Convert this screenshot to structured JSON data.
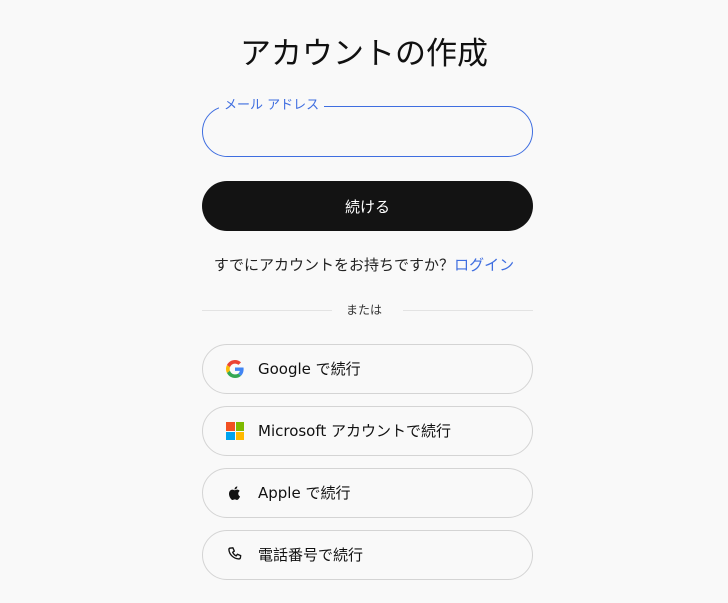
{
  "page": {
    "title": "アカウントの作成"
  },
  "email_field": {
    "label": "メール アドレス",
    "value": "",
    "accent_color": "#3f6ee0"
  },
  "continue_button": {
    "label": "続ける",
    "background": "#131313"
  },
  "login_prompt": {
    "text": "すでにアカウントをお持ちですか？",
    "link_label": "ログイン",
    "link_color": "#3f6ee0"
  },
  "divider": {
    "label": "または"
  },
  "social_buttons": [
    {
      "icon": "google-icon",
      "label": "Google で続行"
    },
    {
      "icon": "microsoft-icon",
      "label": "Microsoft アカウントで続行"
    },
    {
      "icon": "apple-icon",
      "label": "Apple で続行"
    },
    {
      "icon": "phone-icon",
      "label": "電話番号で続行"
    }
  ],
  "colors": {
    "background": "#f9f9f9",
    "text": "#111111",
    "border": "#d4d4d4",
    "google_blue": "#4285F4",
    "google_red": "#EA4335",
    "google_yellow": "#FBBC05",
    "google_green": "#34A853",
    "ms_red": "#F25022",
    "ms_green": "#7FBA00",
    "ms_blue": "#00A4EF",
    "ms_yellow": "#FFB900"
  }
}
